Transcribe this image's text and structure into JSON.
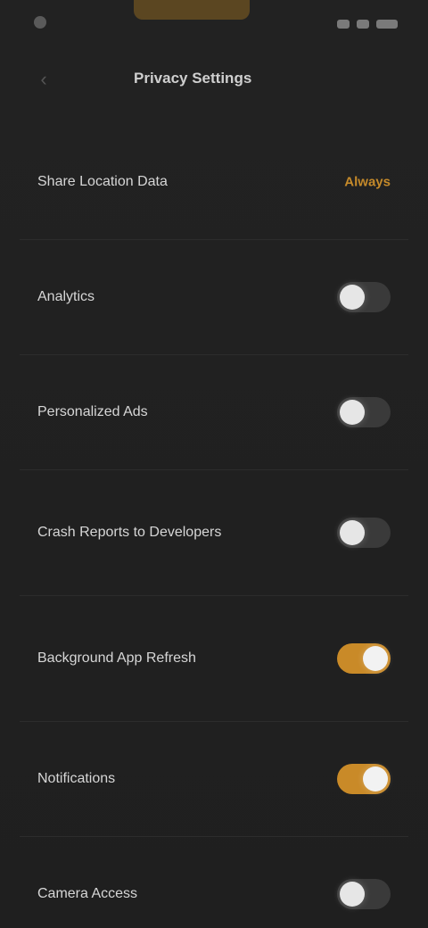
{
  "header": {
    "title": "Privacy Settings"
  },
  "settings": {
    "items": [
      {
        "label": "Share Location Data",
        "value": "Always",
        "type": "value"
      },
      {
        "label": "Analytics",
        "enabled": false,
        "type": "toggle"
      },
      {
        "label": "Personalized Ads",
        "enabled": false,
        "type": "toggle"
      },
      {
        "label": "Crash Reports to Developers",
        "enabled": false,
        "type": "toggle"
      },
      {
        "label": "Background App Refresh",
        "enabled": true,
        "type": "toggle"
      },
      {
        "label": "Notifications",
        "enabled": true,
        "type": "toggle"
      },
      {
        "label": "Camera Access",
        "enabled": false,
        "type": "toggle"
      }
    ]
  },
  "colors": {
    "accent": "#c98a28",
    "background": "#1f1f1f"
  }
}
